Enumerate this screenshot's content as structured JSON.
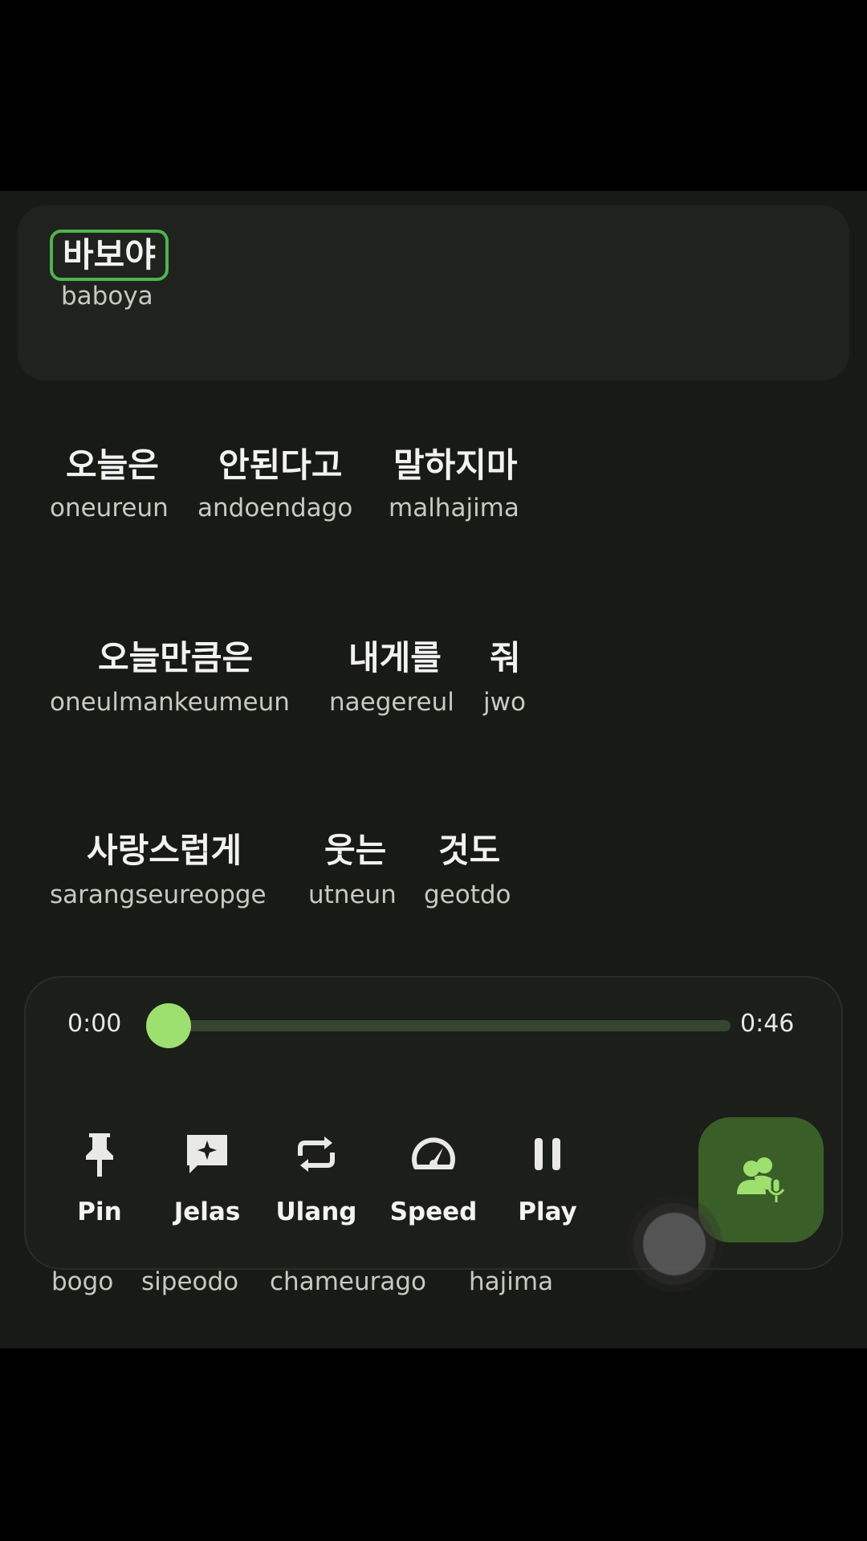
{
  "lyrics": {
    "active": {
      "korean": "바보야",
      "roman": "baboya"
    },
    "lines": [
      {
        "words": [
          {
            "kr": "오늘은",
            "rom": "oneureun"
          },
          {
            "kr": "안된다고",
            "rom": "andoendago"
          },
          {
            "kr": "말하지마",
            "rom": "malhajima"
          }
        ]
      },
      {
        "words": [
          {
            "kr": "오늘만큼은",
            "rom": "oneulmankeumeun"
          },
          {
            "kr": "내게를",
            "rom": "naegereul"
          },
          {
            "kr": "줘",
            "rom": "jwo"
          }
        ]
      },
      {
        "words": [
          {
            "kr": "사랑스럽게",
            "rom": "sarangseureopge"
          },
          {
            "kr": "웃는",
            "rom": "utneun"
          },
          {
            "kr": "것도",
            "rom": "geotdo"
          }
        ]
      },
      {
        "words": [
          {
            "rom": "bogo"
          },
          {
            "rom": "sipeodo"
          },
          {
            "rom": "chameurago"
          },
          {
            "rom": "hajima"
          }
        ]
      }
    ]
  },
  "player": {
    "current_time": "0:00",
    "total_time": "0:46",
    "progress": 0.0,
    "accent_color": "#9ee06f",
    "controls": [
      {
        "label": "Pin",
        "icon": "pin-icon"
      },
      {
        "label": "Jelas",
        "icon": "sparkle-chat-icon"
      },
      {
        "label": "Ulang",
        "icon": "repeat-icon"
      },
      {
        "label": "Speed",
        "icon": "speedometer-icon"
      },
      {
        "label": "Play",
        "icon": "pause-icon"
      }
    ],
    "karaoke_button_icon": "group-mic-icon"
  }
}
